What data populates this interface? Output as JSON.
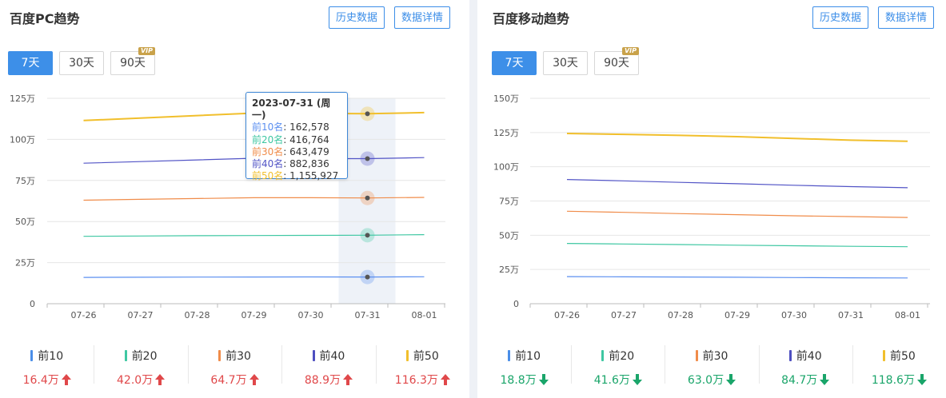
{
  "pc": {
    "title": "百度PC趋势",
    "history_btn": "历史数据",
    "detail_btn": "数据详情",
    "tabs": [
      "7天",
      "30天",
      "90天"
    ],
    "vip": "VIP",
    "tooltip": {
      "date": "2023-07-31 (周一)",
      "rows": [
        {
          "name": "前10名",
          "value": "162,578",
          "color": "#5b8ff0"
        },
        {
          "name": "前20名",
          "value": "416,764",
          "color": "#3ec7a2"
        },
        {
          "name": "前30名",
          "value": "643,479",
          "color": "#f08c4a"
        },
        {
          "name": "前40名",
          "value": "882,836",
          "color": "#5254c6"
        },
        {
          "name": "前50名",
          "value": "1,155,927",
          "color": "#f1bf2c"
        }
      ]
    },
    "stats": [
      {
        "label": "前10",
        "value": "16.4万",
        "color": "#4a8ee8",
        "trend": "up"
      },
      {
        "label": "前20",
        "value": "42.0万",
        "color": "#3ec7a2",
        "trend": "up"
      },
      {
        "label": "前30",
        "value": "64.7万",
        "color": "#f08c4a",
        "trend": "up"
      },
      {
        "label": "前40",
        "value": "88.9万",
        "color": "#4e4fc0",
        "trend": "up"
      },
      {
        "label": "前50",
        "value": "116.3万",
        "color": "#f1bf2c",
        "trend": "up"
      }
    ]
  },
  "mobile": {
    "title": "百度移动趋势",
    "history_btn": "历史数据",
    "detail_btn": "数据详情",
    "tabs": [
      "7天",
      "30天",
      "90天"
    ],
    "vip": "VIP",
    "stats": [
      {
        "label": "前10",
        "value": "18.8万",
        "color": "#4a8ee8",
        "trend": "down"
      },
      {
        "label": "前20",
        "value": "41.6万",
        "color": "#3ec7a2",
        "trend": "down"
      },
      {
        "label": "前30",
        "value": "63.0万",
        "color": "#f08c4a",
        "trend": "down"
      },
      {
        "label": "前40",
        "value": "84.7万",
        "color": "#4e4fc0",
        "trend": "down"
      },
      {
        "label": "前50",
        "value": "118.6万",
        "color": "#f1bf2c",
        "trend": "down"
      }
    ]
  },
  "chart_data": [
    {
      "type": "line",
      "title": "百度PC趋势",
      "x": [
        "07-26",
        "07-27",
        "07-28",
        "07-29",
        "07-30",
        "07-31",
        "08-01"
      ],
      "yticks": [
        "0",
        "25万",
        "50万",
        "75万",
        "100万",
        "125万"
      ],
      "ylim": [
        0,
        1250000
      ],
      "grid": true,
      "highlight_index": 5,
      "series": [
        {
          "name": "前10名",
          "color": "#5b8ff0",
          "values": [
            160000,
            161000,
            162000,
            162500,
            163000,
            162578,
            164000
          ]
        },
        {
          "name": "前20名",
          "color": "#3ec7a2",
          "values": [
            410000,
            412000,
            414000,
            415000,
            416000,
            416764,
            420000
          ]
        },
        {
          "name": "前30名",
          "color": "#f08c4a",
          "values": [
            630000,
            635000,
            640000,
            645000,
            645000,
            643479,
            647000
          ]
        },
        {
          "name": "前40名",
          "color": "#5254c6",
          "values": [
            855000,
            865000,
            875000,
            885000,
            883000,
            882836,
            889000
          ]
        },
        {
          "name": "前50名",
          "color": "#f1bf2c",
          "values": [
            1115000,
            1130000,
            1145000,
            1160000,
            1158000,
            1155927,
            1163000
          ]
        }
      ]
    },
    {
      "type": "line",
      "title": "百度移动趋势",
      "x": [
        "07-26",
        "07-27",
        "07-28",
        "07-29",
        "07-30",
        "07-31",
        "08-01"
      ],
      "yticks": [
        "0",
        "25万",
        "50万",
        "75万",
        "100万",
        "125万",
        "150万"
      ],
      "ylim": [
        0,
        1500000
      ],
      "grid": true,
      "series": [
        {
          "name": "前10",
          "color": "#5b8ff0",
          "values": [
            198000,
            196000,
            195000,
            193000,
            191000,
            189000,
            188000
          ]
        },
        {
          "name": "前20",
          "color": "#3ec7a2",
          "values": [
            440000,
            436000,
            432000,
            427000,
            423000,
            419000,
            416000
          ]
        },
        {
          "name": "前30",
          "color": "#f08c4a",
          "values": [
            675000,
            667000,
            658000,
            650000,
            642000,
            636000,
            630000
          ]
        },
        {
          "name": "前40",
          "color": "#5254c6",
          "values": [
            907000,
            897000,
            886000,
            876000,
            865000,
            855000,
            847000
          ]
        },
        {
          "name": "前50",
          "color": "#f1bf2c",
          "values": [
            1243000,
            1237000,
            1229000,
            1220000,
            1207000,
            1194000,
            1186000
          ]
        }
      ]
    }
  ]
}
